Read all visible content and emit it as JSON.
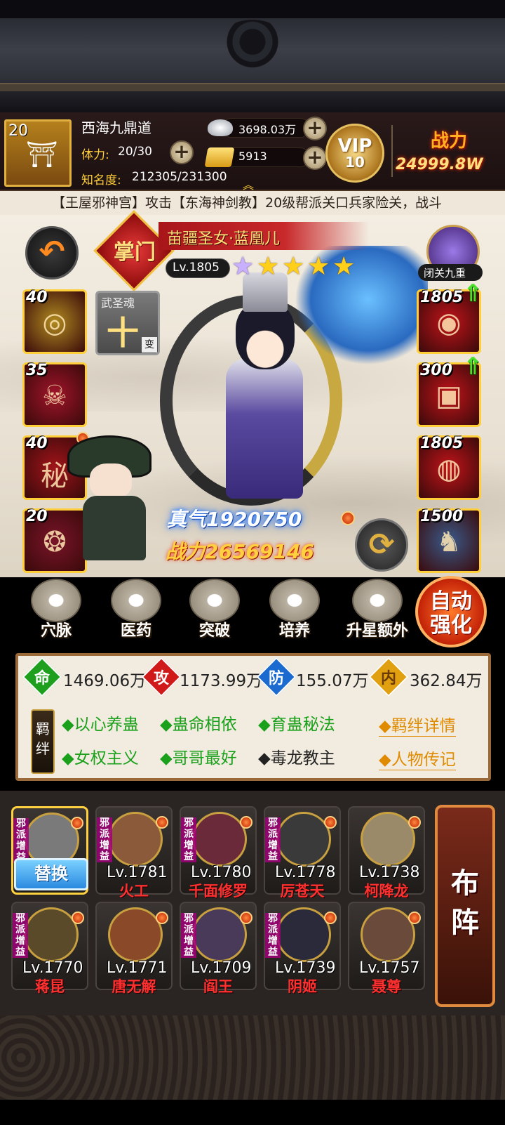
{
  "player": {
    "level": "20",
    "name": "西海九鼎道",
    "stamina_label": "体力:",
    "stamina_value": "20/30",
    "fame_label": "知名度:",
    "fame_value": "212305/231300",
    "silver": "3698.03万",
    "gold": "5913",
    "vip_label": "VIP",
    "vip_level": "10",
    "power_label": "战力",
    "power_value": "24999.8W"
  },
  "marquee": "【王屋邪神宫】攻击【东海神剑教】20级帮派关口兵家险关，战斗",
  "hero": {
    "rank": "掌门",
    "name": "苗疆圣女·蓝凰儿",
    "level": "Lv.1805",
    "stars_purple": 1,
    "stars_gold": 4,
    "seclusion_label": "闭关九重",
    "soul_label": "武圣魂",
    "soul_glyph": "十",
    "soul_change": "变",
    "qi": "真气1920750",
    "power": "战力26569146"
  },
  "equip_left": [
    {
      "num": "40",
      "glyph": "◎",
      "color": "#b08a20",
      "dot": false
    },
    {
      "num": "35",
      "glyph": "☠",
      "color": "#a0142a",
      "dot": false
    },
    {
      "num": "40",
      "glyph": "秘",
      "color": "#a0141a",
      "dot": true
    },
    {
      "num": "20",
      "glyph": "❂",
      "color": "#7a1428",
      "dot": false
    }
  ],
  "equip_right": [
    {
      "num": "1805",
      "glyph": "◉",
      "color": "#c0141a",
      "arrow": true
    },
    {
      "num": "300",
      "glyph": "▣",
      "color": "#c0141a",
      "arrow": true
    },
    {
      "num": "1805",
      "glyph": "◍",
      "color": "#c0141a",
      "arrow": false
    },
    {
      "num": "1500",
      "glyph": "♞",
      "color": "#3a5a8a",
      "arrow": false
    }
  ],
  "actions": [
    "穴脉",
    "医药",
    "突破",
    "培养",
    "升星额外"
  ],
  "auto_button": "自动强化",
  "stats": {
    "hp_icon": "命",
    "hp": "1469.06万",
    "atk_icon": "攻",
    "atk": "1173.99万",
    "def_icon": "防",
    "def": "155.07万",
    "int_icon": "内",
    "int": "362.84万"
  },
  "bonds": {
    "badge": "羁绊",
    "row1": [
      "◆以心养蛊",
      "◆蛊命相依",
      "◆育蛊秘法"
    ],
    "row2": [
      "◆女权主义",
      "◆哥哥最好",
      "◆毒龙教主"
    ],
    "bond_details": "◆羁绊详情",
    "biography": "◆人物传记"
  },
  "lineup": {
    "replace_label": "替换",
    "tag": "邪派增益",
    "formation_label": "布阵",
    "members": [
      {
        "level": "",
        "name": "",
        "color": "#7a7a7a"
      },
      {
        "level": "Lv.1781",
        "name": "火工",
        "color": "#8a5a3a"
      },
      {
        "level": "Lv.1780",
        "name": "千面修罗",
        "color": "#6a2a3a"
      },
      {
        "level": "Lv.1778",
        "name": "厉苍天",
        "color": "#3a3a3a"
      },
      {
        "level": "Lv.1738",
        "name": "柯降龙",
        "color": "#9a8a6a"
      },
      {
        "level": "Lv.1770",
        "name": "蒋昆",
        "color": "#5a4a2a"
      },
      {
        "level": "Lv.1771",
        "name": "唐无解",
        "color": "#8a4a2a"
      },
      {
        "level": "Lv.1709",
        "name": "阎王",
        "color": "#4a3a5a"
      },
      {
        "level": "Lv.1739",
        "name": "阴姬",
        "color": "#2a2a3a"
      },
      {
        "level": "Lv.1757",
        "name": "聂尊",
        "color": "#6a4a3a"
      }
    ]
  }
}
